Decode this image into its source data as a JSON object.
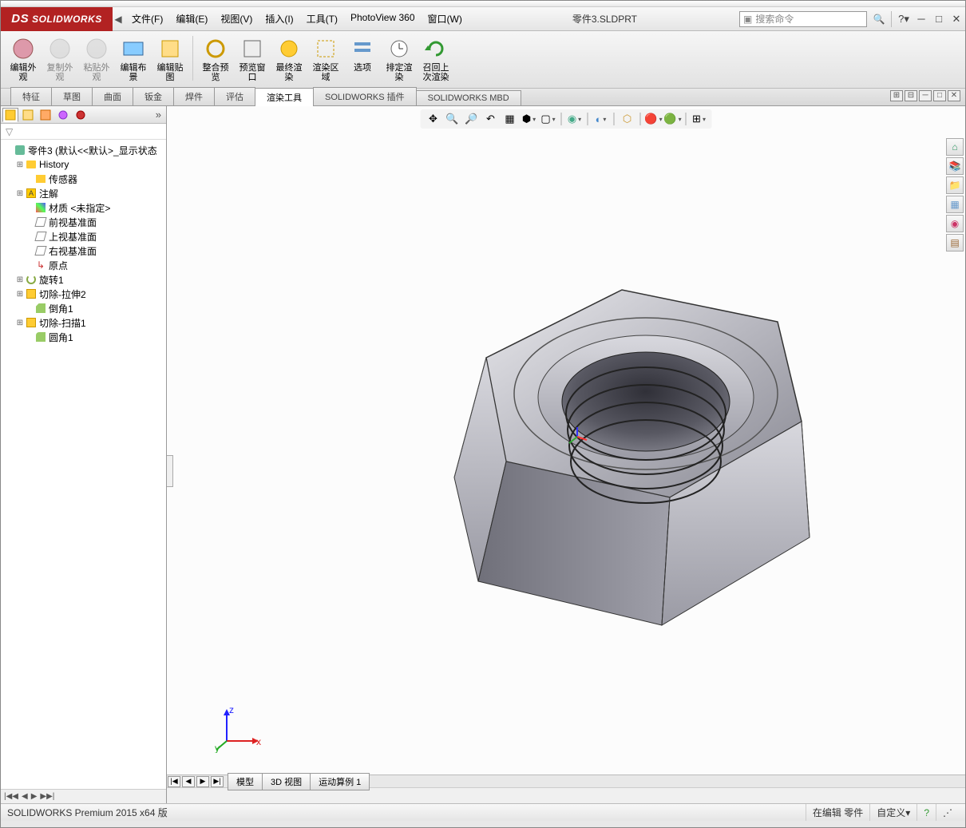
{
  "app": {
    "logo": "SOLIDWORKS"
  },
  "menu": {
    "items": [
      "文件(F)",
      "编辑(E)",
      "视图(V)",
      "插入(I)",
      "工具(T)",
      "PhotoView 360",
      "窗口(W)"
    ]
  },
  "document_title": "零件3.SLDPRT",
  "search": {
    "placeholder": "搜索命令"
  },
  "ribbon": {
    "buttons": [
      {
        "label": "编辑外\n观",
        "disabled": false
      },
      {
        "label": "复制外\n观",
        "disabled": true
      },
      {
        "label": "粘贴外\n观",
        "disabled": true
      },
      {
        "label": "编辑布\n景",
        "disabled": false
      },
      {
        "label": "编辑贴\n图",
        "disabled": false
      },
      {
        "label": "整合预\n览",
        "disabled": false
      },
      {
        "label": "预览窗\n口",
        "disabled": false
      },
      {
        "label": "最终渲\n染",
        "disabled": false
      },
      {
        "label": "渲染区\n域",
        "disabled": false
      },
      {
        "label": "选项",
        "disabled": false
      },
      {
        "label": "排定渲\n染",
        "disabled": false
      },
      {
        "label": "召回上\n次渲染",
        "disabled": false
      }
    ]
  },
  "tabs": {
    "items": [
      "特征",
      "草图",
      "曲面",
      "钣金",
      "焊件",
      "评估",
      "渲染工具",
      "SOLIDWORKS 插件",
      "SOLIDWORKS MBD"
    ],
    "active_index": 6
  },
  "tree": {
    "root": "零件3  (默认<<默认>_显示状态",
    "items": [
      {
        "label": "History",
        "icon": "folder",
        "expand": "+",
        "indent": 1
      },
      {
        "label": "传感器",
        "icon": "sensor",
        "expand": "",
        "indent": 2
      },
      {
        "label": "注解",
        "icon": "annot",
        "expand": "+",
        "indent": 1
      },
      {
        "label": "材质 <未指定>",
        "icon": "mat",
        "expand": "",
        "indent": 2
      },
      {
        "label": "前视基准面",
        "icon": "plane",
        "expand": "",
        "indent": 2
      },
      {
        "label": "上视基准面",
        "icon": "plane",
        "expand": "",
        "indent": 2
      },
      {
        "label": "右视基准面",
        "icon": "plane",
        "expand": "",
        "indent": 2
      },
      {
        "label": "原点",
        "icon": "origin",
        "expand": "",
        "indent": 2
      },
      {
        "label": "旋转1",
        "icon": "rev",
        "expand": "+",
        "indent": 1
      },
      {
        "label": "切除-拉伸2",
        "icon": "cut",
        "expand": "+",
        "indent": 1
      },
      {
        "label": "倒角1",
        "icon": "chamfer",
        "expand": "",
        "indent": 2
      },
      {
        "label": "切除-扫描1",
        "icon": "sweep",
        "expand": "+",
        "indent": 1
      },
      {
        "label": "圆角1",
        "icon": "fillet",
        "expand": "",
        "indent": 2
      }
    ]
  },
  "bottom_tabs": [
    "模型",
    "3D 视图",
    "运动算例 1"
  ],
  "status": {
    "left": "SOLIDWORKS Premium 2015 x64 版",
    "editing": "在编辑 零件",
    "custom": "自定义"
  },
  "coord": {
    "x": "x",
    "y": "y",
    "z": "z"
  }
}
